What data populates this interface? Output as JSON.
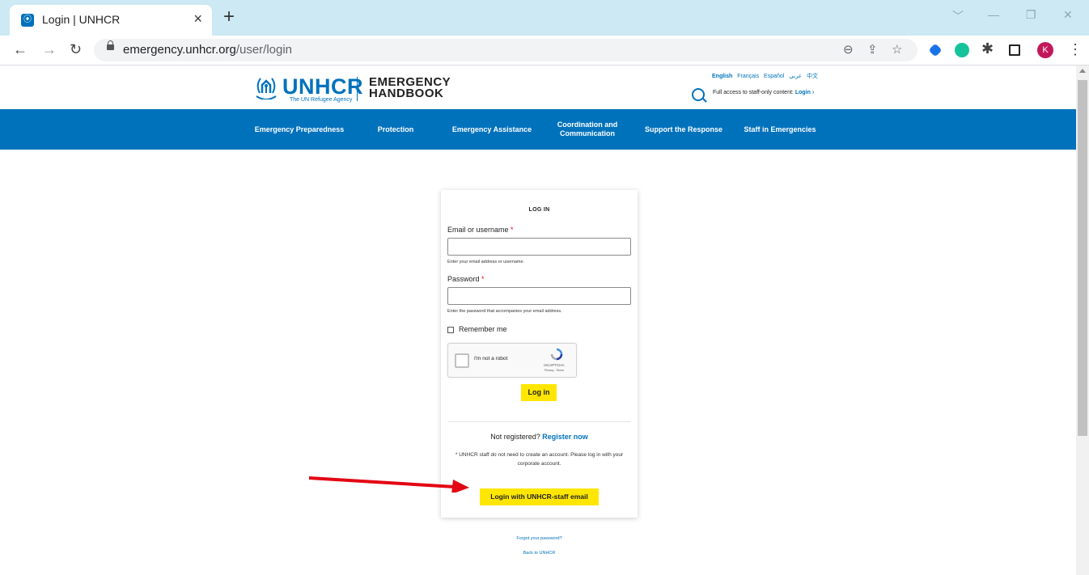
{
  "browser": {
    "tab_title": "Login | UNHCR",
    "tab_close": "×",
    "new_tab": "+",
    "url_host": "emergency.unhcr.org",
    "url_path": "/user/login",
    "profile_initial": "K",
    "nav_icons": [
      "back-arrow-icon",
      "forward-arrow-icon",
      "reload-icon"
    ],
    "omnibox_icons": [
      "zoom-icon",
      "share-icon",
      "bookmark-star-icon"
    ],
    "extension_icons": [
      "extension-blue-icon",
      "grammarly-icon",
      "puzzle-icon",
      "sidepanel-icon"
    ]
  },
  "header": {
    "logo_word": "UNHCR",
    "logo_tagline": "The UN Refugee Agency",
    "handbook_line1": "EMERGENCY",
    "handbook_line2": "HANDBOOK",
    "languages": [
      "English",
      "Français",
      "Español",
      "عربي",
      "中文"
    ],
    "active_language": "English",
    "staff_access_text": "Full access to staff-only content:",
    "staff_access_link": "Login ›"
  },
  "nav": {
    "items": [
      "Emergency Preparedness",
      "Protection",
      "Emergency Assistance",
      "Coordination and Communication",
      "Support the Response",
      "Staff in Emergencies"
    ]
  },
  "login": {
    "title": "LOG IN",
    "email_label": "Email or username",
    "email_value": "",
    "email_help": "Enter your email address or username.",
    "password_label": "Password",
    "password_value": "",
    "password_help": "Enter the password that accompanies your email address.",
    "required_mark": "*",
    "remember_label": "Remember me",
    "captcha_label": "I'm not a robot",
    "captcha_brand": "reCAPTCHA",
    "captcha_links": "Privacy - Terms",
    "login_button": "Log in",
    "not_registered": "Not registered?",
    "register_link": "Register now",
    "staff_note": "* UNHCR staff do not need to create an account. Please log in with your corporate account.",
    "staff_button": "Login with UNHCR-staff email"
  },
  "footer_links": {
    "forgot": "Forgot your password?",
    "back": "Back to UNHCR"
  },
  "colors": {
    "brand_blue": "#0072bc",
    "button_yellow": "#ffe600",
    "arrow_red": "#e30613",
    "tabbar": "#cde9f3"
  }
}
